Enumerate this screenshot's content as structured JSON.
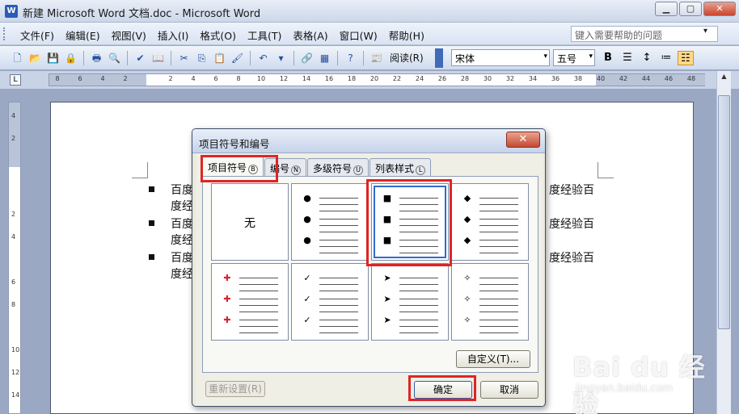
{
  "window": {
    "title": "新建 Microsoft Word 文档.doc - Microsoft Word",
    "app_icon": "W",
    "minimize": "▁",
    "maximize": "▢",
    "close": "✕"
  },
  "menubar": {
    "items": [
      "文件(F)",
      "编辑(E)",
      "视图(V)",
      "插入(I)",
      "格式(O)",
      "工具(T)",
      "表格(A)",
      "窗口(W)",
      "帮助(H)"
    ],
    "help_placeholder": "键入需要帮助的问题",
    "help_dropdown": "▾"
  },
  "toolbar": {
    "read_label": "阅读(R)",
    "font_name": "宋体",
    "font_size": "五号",
    "bold_label": "B",
    "dropdown": "▾"
  },
  "ruler": {
    "numbers": [
      "8",
      "6",
      "4",
      "2",
      "2",
      "4",
      "6",
      "8",
      "10",
      "12",
      "14",
      "16",
      "18",
      "20",
      "22",
      "24",
      "26",
      "28",
      "30",
      "32",
      "34",
      "36",
      "38",
      "40",
      "42",
      "44",
      "46",
      "48"
    ],
    "vnumbers": [
      "4",
      "2",
      "2",
      "4",
      "6",
      "8",
      "10",
      "12",
      "14"
    ]
  },
  "document": {
    "lines": [
      {
        "left": "百度",
        "right": "度经验百",
        "cont": "度经"
      },
      {
        "left": "百度",
        "right": "度经验百",
        "cont": "度经"
      },
      {
        "left": "百度",
        "right": "度经验百",
        "cont": "度经"
      }
    ]
  },
  "dialog": {
    "title": "项目符号和编号",
    "close": "✕",
    "tabs": [
      {
        "label": "项目符号",
        "key": "B"
      },
      {
        "label": "编号",
        "key": "N"
      },
      {
        "label": "多级符号",
        "key": "U"
      },
      {
        "label": "列表样式",
        "key": "L"
      }
    ],
    "none_label": "无",
    "bullets": {
      "cell2": "●",
      "cell3": "■",
      "cell4": "◆",
      "cell5": "✚",
      "cell6": "✓",
      "cell7": "➤",
      "cell8": "✧"
    },
    "custom_button": "自定义(T)...",
    "reset_button": "重新设置(R)",
    "ok_button": "确定",
    "cancel_button": "取消"
  },
  "watermark": {
    "main": "Bai du 经验",
    "sub": "jingyan.baidu.com"
  },
  "colors": {
    "highlight": "#e02424",
    "selection": "#2f6bd1"
  }
}
